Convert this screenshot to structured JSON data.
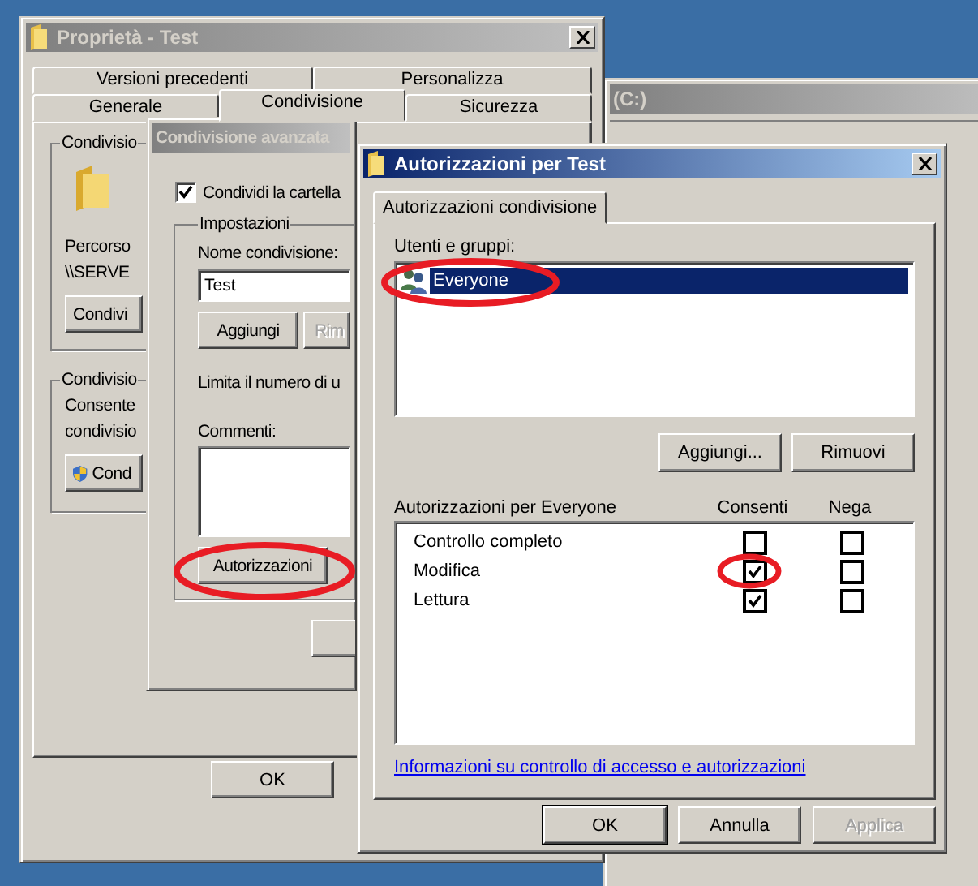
{
  "explorer_window": {
    "title": "(C:)"
  },
  "properties_window": {
    "title": "Proprietà - Test",
    "tab_rows": [
      {
        "tabs": [
          {
            "label": "Versioni precedenti",
            "selected": false
          },
          {
            "label": "Personalizza",
            "selected": false
          }
        ]
      },
      {
        "tabs": [
          {
            "label": "Generale",
            "selected": false
          },
          {
            "label": "Condivisione",
            "selected": true
          },
          {
            "label": "Sicurezza",
            "selected": false
          }
        ]
      }
    ],
    "groups": [
      {
        "title": "Condivisio",
        "kind": "path",
        "lines": [
          "Percorso",
          "\\\\SERVE"
        ],
        "button": "Condivi"
      },
      {
        "title": "Condivisio",
        "kind": "advanced",
        "lines": [
          "Consente",
          "condivisio"
        ],
        "button": "Cond"
      }
    ],
    "buttons": [
      "OK"
    ]
  },
  "advanced_window": {
    "title": "Condivisione avanzata",
    "share": {
      "label": "Condividi la cartella",
      "checked": true
    },
    "settings_title": "Impostazioni",
    "name_label": "Nome condivisione:",
    "name_value": "Test",
    "buttons": [
      {
        "label": "Aggiungi",
        "disabled": false
      },
      {
        "label": "Rim",
        "disabled": true
      }
    ],
    "limit_label": "Limita il numero di u",
    "comments_label": "Commenti:",
    "permissions_button": "Autorizzazioni"
  },
  "permissions_window": {
    "title": "Autorizzazioni per Test",
    "tabs": [
      {
        "label": "Autorizzazioni condivisione",
        "selected": true
      }
    ],
    "users_label": "Utenti e gruppi:",
    "users": [
      {
        "name": "Everyone",
        "selected": true
      }
    ],
    "user_buttons": [
      "Aggiungi...",
      "Rimuovi"
    ],
    "perm_header": {
      "label": "Autorizzazioni per Everyone",
      "allow": "Consenti",
      "deny": "Nega"
    },
    "permissions": [
      {
        "name": "Controllo completo",
        "allow": false,
        "deny": false
      },
      {
        "name": "Modifica",
        "allow": true,
        "deny": false
      },
      {
        "name": "Lettura",
        "allow": true,
        "deny": false
      }
    ],
    "link": "Informazioni su controllo di accesso e autorizzazioni",
    "buttons": [
      {
        "label": "OK",
        "disabled": false,
        "default": true
      },
      {
        "label": "Annulla",
        "disabled": false,
        "default": false
      },
      {
        "label": "Applica",
        "disabled": true,
        "default": false
      }
    ]
  }
}
